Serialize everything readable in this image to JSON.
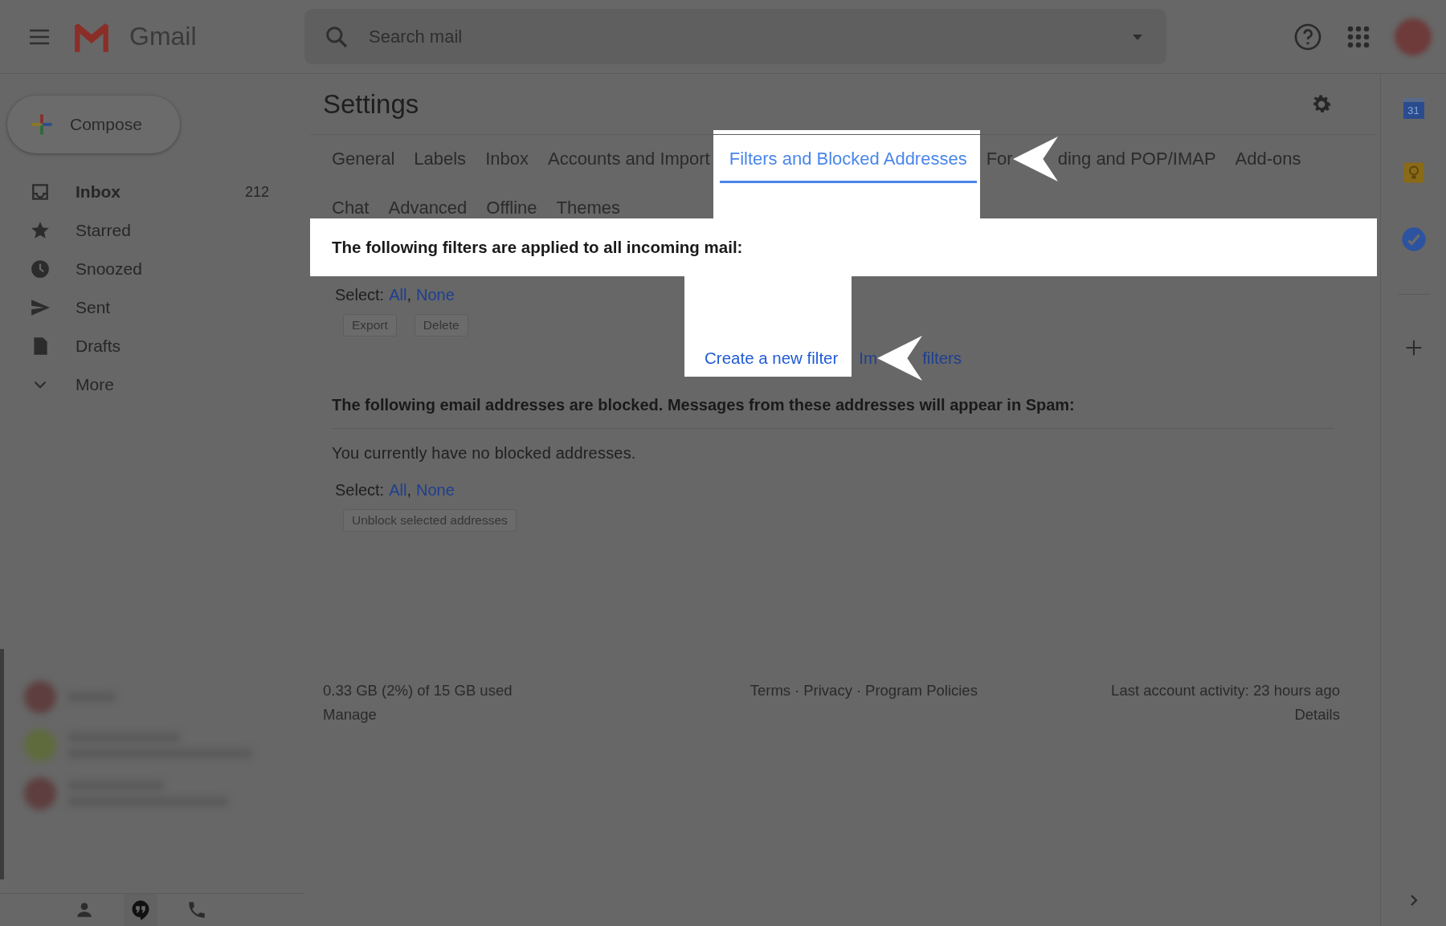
{
  "header": {
    "app_name": "Gmail",
    "search": {
      "placeholder": "Search mail"
    }
  },
  "sidebar": {
    "compose": "Compose",
    "items": [
      {
        "label": "Inbox",
        "count": "212",
        "selected": true
      },
      {
        "label": "Starred",
        "selected": false
      },
      {
        "label": "Snoozed",
        "selected": false
      },
      {
        "label": "Sent",
        "selected": false
      },
      {
        "label": "Drafts",
        "selected": false
      },
      {
        "label": "More",
        "selected": false
      }
    ]
  },
  "settings": {
    "title": "Settings",
    "tab_rows": [
      [
        {
          "parts": [
            "General"
          ],
          "selected": false
        },
        {
          "parts": [
            "Labels"
          ],
          "selected": false
        },
        {
          "parts": [
            "Inbox"
          ],
          "selected": false
        },
        {
          "parts": [
            "Accounts and Import"
          ],
          "selected": false
        },
        {
          "parts": [
            "Filters and Blocked Addresses"
          ],
          "selected": true
        },
        {
          "parts": [
            "For",
            "ding and POP/IMAP"
          ],
          "selected": false
        },
        {
          "parts": [
            "Add-ons"
          ],
          "selected": false
        }
      ],
      [
        {
          "parts": [
            "Chat"
          ],
          "selected": false
        },
        {
          "parts": [
            "Advanced"
          ],
          "selected": false
        },
        {
          "parts": [
            "Offline"
          ],
          "selected": false
        },
        {
          "parts": [
            "Themes"
          ],
          "selected": false
        }
      ]
    ],
    "filters": {
      "heading": "The following filters are applied to all incoming mail:",
      "highlighted": true,
      "select": {
        "label": "Select:",
        "links": [
          "All",
          "None"
        ],
        "separator": ","
      },
      "buttons": [
        "Export",
        "Delete"
      ],
      "links": [
        {
          "parts": [
            "Create a new filter"
          ],
          "highlighted": true
        },
        {
          "parts": [
            "Im",
            "filters"
          ],
          "highlighted": false
        }
      ]
    },
    "blocked": {
      "heading": "The following email addresses are blocked. Messages from these addresses will appear in Spam:",
      "message": "You currently have no blocked addresses.",
      "select": {
        "label": "Select:",
        "links": [
          "All",
          "None"
        ],
        "separator": ","
      },
      "buttons": [
        "Unblock selected addresses"
      ]
    },
    "footer": {
      "storage": "0.33 GB (2%) of 15 GB used",
      "manage": "Manage",
      "links": [
        "Terms",
        "Privacy",
        "Program Policies"
      ],
      "separator": "·",
      "activity": "Last account activity: 23 hours ago",
      "details": "Details"
    }
  },
  "right_panel": {
    "calendar_day": "31"
  }
}
